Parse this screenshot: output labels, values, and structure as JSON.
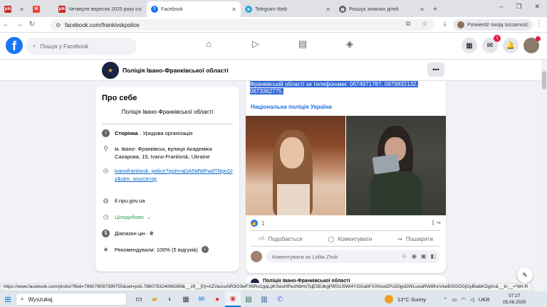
{
  "browser": {
    "tabs": [
      {
        "label": "",
        "favicon": "pik",
        "color": "#c62828"
      },
      {
        "label": "",
        "favicon": "gmail",
        "color": "#ea4335"
      },
      {
        "label": "Четверте вересня 2025 року о",
        "favicon": "pik",
        "color": "#c62828"
      },
      {
        "label": "Facebook",
        "favicon": "facebook",
        "color": "#1877f2"
      },
      {
        "label": "Telegram Web",
        "favicon": "telegram",
        "color": "#2aa3df"
      },
      {
        "label": "Розшук зниклих дітей",
        "favicon": "globe",
        "color": "#5f6368"
      }
    ],
    "tab_glyphs": {
      "pik": "pik",
      "gmail": "M",
      "close": "✕",
      "new_tab": "+"
    },
    "url": "facebook.com/frankivskpolice",
    "profile_chip": "Potwierdź swoją tożsamość",
    "window_controls": {
      "minimize": "–",
      "maximize": "❐",
      "close": "✕"
    }
  },
  "facebook": {
    "search_placeholder": "Пошук у Facebook",
    "notification_count": "1",
    "logo_letter": "f"
  },
  "page_header": {
    "name": "Поліція Івано-Франківської області",
    "more": "•••"
  },
  "about": {
    "title": "Про себе",
    "intro": "Поліція Івано-Франківської області",
    "category_bold": "Сторінка",
    "category_rest": " · Урядова організація",
    "address": "м. Івано- Франківськ, вулиця Академіка Сахарова, 15, Ivano-Frankivsk, Ukraine",
    "instagram": "ivanofrankivsk_police?igsh=aDA5MWFwdTNpcGIz&utm_source=qr",
    "website": "if.npu.gov.ua",
    "hours": "Цілодобово",
    "price": "Діапазон цін · ₴",
    "rating": "Рекомендували: 100% (5 відгуків)"
  },
  "post": {
    "selected_text": "Франківській області за телефонами: 0674971787, 0979832132, 0673362775.",
    "hashtag": "Національна поліція України",
    "likes": "1",
    "shares": "1",
    "like_label": "Подобається",
    "comment_label": "Коментувати",
    "share_label": "Поширити",
    "comment_placeholder": "Коментувати як Lidiia Zhuk"
  },
  "next_post": {
    "author": "Поліція Івано-Франківської області"
  },
  "status_url": "https://www.facebook.com/photo/?fbid=786078097399755&set=pcb.786078324066399&__cft__[0]=AZVascuNR3O3wFX6Ro1gqLpKSeuHPezNbHsTsjE5EdkgP8fS1I5Wi4YOGabFXXhswZPcD0gsDWLuoaRW8fncVkeBSlSOGjGyBtabKDgIm&__tn__=*bH-R",
  "taskbar": {
    "search": "Wyszukaj",
    "weather": "13°C  Sunny",
    "lang": "UKR",
    "time": "07:27",
    "date": "05.06.2025"
  },
  "colors": {
    "fb_blue": "#1877f2",
    "link": "#0064d1",
    "open_green": "#31a24c",
    "selection": "#3367d6"
  }
}
